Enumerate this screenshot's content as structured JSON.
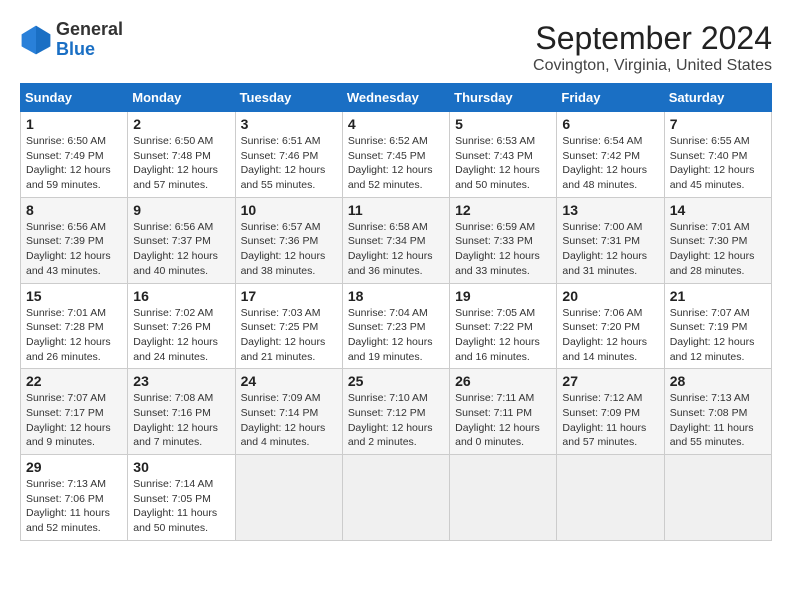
{
  "logo": {
    "text_general": "General",
    "text_blue": "Blue"
  },
  "title": "September 2024",
  "subtitle": "Covington, Virginia, United States",
  "days_of_week": [
    "Sunday",
    "Monday",
    "Tuesday",
    "Wednesday",
    "Thursday",
    "Friday",
    "Saturday"
  ],
  "weeks": [
    [
      {
        "day": "1",
        "content": "Sunrise: 6:50 AM\nSunset: 7:49 PM\nDaylight: 12 hours\nand 59 minutes."
      },
      {
        "day": "2",
        "content": "Sunrise: 6:50 AM\nSunset: 7:48 PM\nDaylight: 12 hours\nand 57 minutes."
      },
      {
        "day": "3",
        "content": "Sunrise: 6:51 AM\nSunset: 7:46 PM\nDaylight: 12 hours\nand 55 minutes."
      },
      {
        "day": "4",
        "content": "Sunrise: 6:52 AM\nSunset: 7:45 PM\nDaylight: 12 hours\nand 52 minutes."
      },
      {
        "day": "5",
        "content": "Sunrise: 6:53 AM\nSunset: 7:43 PM\nDaylight: 12 hours\nand 50 minutes."
      },
      {
        "day": "6",
        "content": "Sunrise: 6:54 AM\nSunset: 7:42 PM\nDaylight: 12 hours\nand 48 minutes."
      },
      {
        "day": "7",
        "content": "Sunrise: 6:55 AM\nSunset: 7:40 PM\nDaylight: 12 hours\nand 45 minutes."
      }
    ],
    [
      {
        "day": "8",
        "content": "Sunrise: 6:56 AM\nSunset: 7:39 PM\nDaylight: 12 hours\nand 43 minutes."
      },
      {
        "day": "9",
        "content": "Sunrise: 6:56 AM\nSunset: 7:37 PM\nDaylight: 12 hours\nand 40 minutes."
      },
      {
        "day": "10",
        "content": "Sunrise: 6:57 AM\nSunset: 7:36 PM\nDaylight: 12 hours\nand 38 minutes."
      },
      {
        "day": "11",
        "content": "Sunrise: 6:58 AM\nSunset: 7:34 PM\nDaylight: 12 hours\nand 36 minutes."
      },
      {
        "day": "12",
        "content": "Sunrise: 6:59 AM\nSunset: 7:33 PM\nDaylight: 12 hours\nand 33 minutes."
      },
      {
        "day": "13",
        "content": "Sunrise: 7:00 AM\nSunset: 7:31 PM\nDaylight: 12 hours\nand 31 minutes."
      },
      {
        "day": "14",
        "content": "Sunrise: 7:01 AM\nSunset: 7:30 PM\nDaylight: 12 hours\nand 28 minutes."
      }
    ],
    [
      {
        "day": "15",
        "content": "Sunrise: 7:01 AM\nSunset: 7:28 PM\nDaylight: 12 hours\nand 26 minutes."
      },
      {
        "day": "16",
        "content": "Sunrise: 7:02 AM\nSunset: 7:26 PM\nDaylight: 12 hours\nand 24 minutes."
      },
      {
        "day": "17",
        "content": "Sunrise: 7:03 AM\nSunset: 7:25 PM\nDaylight: 12 hours\nand 21 minutes."
      },
      {
        "day": "18",
        "content": "Sunrise: 7:04 AM\nSunset: 7:23 PM\nDaylight: 12 hours\nand 19 minutes."
      },
      {
        "day": "19",
        "content": "Sunrise: 7:05 AM\nSunset: 7:22 PM\nDaylight: 12 hours\nand 16 minutes."
      },
      {
        "day": "20",
        "content": "Sunrise: 7:06 AM\nSunset: 7:20 PM\nDaylight: 12 hours\nand 14 minutes."
      },
      {
        "day": "21",
        "content": "Sunrise: 7:07 AM\nSunset: 7:19 PM\nDaylight: 12 hours\nand 12 minutes."
      }
    ],
    [
      {
        "day": "22",
        "content": "Sunrise: 7:07 AM\nSunset: 7:17 PM\nDaylight: 12 hours\nand 9 minutes."
      },
      {
        "day": "23",
        "content": "Sunrise: 7:08 AM\nSunset: 7:16 PM\nDaylight: 12 hours\nand 7 minutes."
      },
      {
        "day": "24",
        "content": "Sunrise: 7:09 AM\nSunset: 7:14 PM\nDaylight: 12 hours\nand 4 minutes."
      },
      {
        "day": "25",
        "content": "Sunrise: 7:10 AM\nSunset: 7:12 PM\nDaylight: 12 hours\nand 2 minutes."
      },
      {
        "day": "26",
        "content": "Sunrise: 7:11 AM\nSunset: 7:11 PM\nDaylight: 12 hours\nand 0 minutes."
      },
      {
        "day": "27",
        "content": "Sunrise: 7:12 AM\nSunset: 7:09 PM\nDaylight: 11 hours\nand 57 minutes."
      },
      {
        "day": "28",
        "content": "Sunrise: 7:13 AM\nSunset: 7:08 PM\nDaylight: 11 hours\nand 55 minutes."
      }
    ],
    [
      {
        "day": "29",
        "content": "Sunrise: 7:13 AM\nSunset: 7:06 PM\nDaylight: 11 hours\nand 52 minutes."
      },
      {
        "day": "30",
        "content": "Sunrise: 7:14 AM\nSunset: 7:05 PM\nDaylight: 11 hours\nand 50 minutes."
      },
      {
        "day": "",
        "content": ""
      },
      {
        "day": "",
        "content": ""
      },
      {
        "day": "",
        "content": ""
      },
      {
        "day": "",
        "content": ""
      },
      {
        "day": "",
        "content": ""
      }
    ]
  ]
}
